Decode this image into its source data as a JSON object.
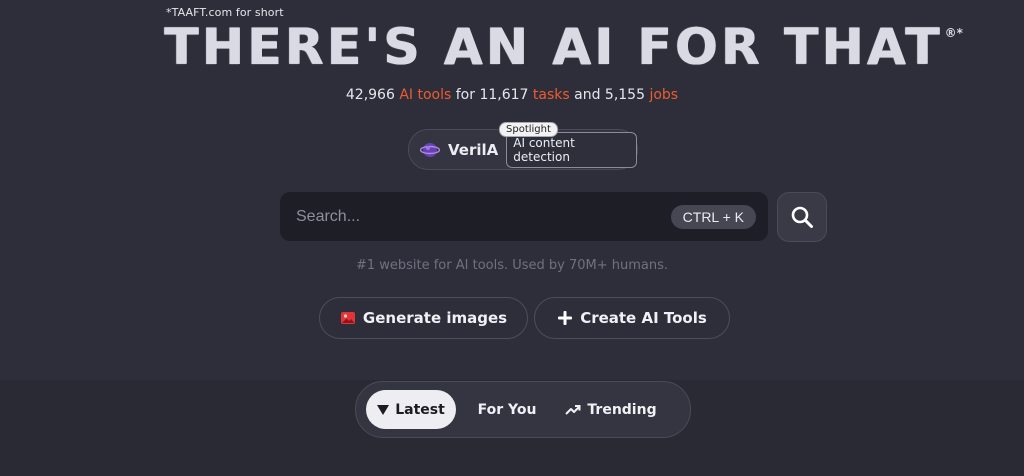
{
  "header": {
    "short_note": "*TAAFT.com for short",
    "title": "THERE'S AN AI FOR THAT",
    "title_mark": "®*"
  },
  "stats": {
    "tools_count": "42,966",
    "tools_label": "AI tools",
    "for_text": "for",
    "tasks_count": "11,617",
    "tasks_label": "tasks",
    "and_text": "and",
    "jobs_count": "5,155",
    "jobs_label": "jobs",
    "accent_color": "#ef5b30"
  },
  "spotlight": {
    "badge": "Spotlight",
    "name": "VerilA",
    "description": "AI content detection",
    "logo_icon": "globe-logo-icon"
  },
  "search": {
    "placeholder": "Search...",
    "value": "",
    "shortcut": "CTRL + K",
    "button_icon": "search-icon"
  },
  "tagline": "#1 website for AI tools. Used by 70M+ humans.",
  "actions": [
    {
      "label": "Generate images",
      "icon": "image-icon"
    },
    {
      "label": "Create AI Tools",
      "icon": "plus-icon"
    }
  ],
  "tabs": [
    {
      "label": "Latest",
      "icon": "triangle-down-icon",
      "selected": true
    },
    {
      "label": "For You",
      "selected": false
    },
    {
      "label": "Trending",
      "icon": "trending-up-icon",
      "selected": false
    }
  ]
}
